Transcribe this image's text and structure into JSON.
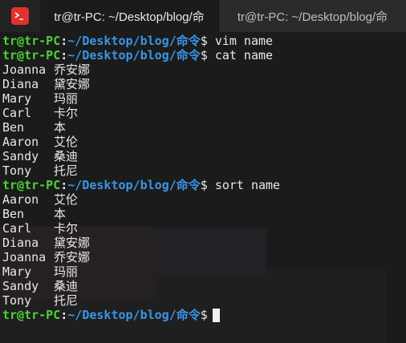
{
  "tabs": [
    {
      "title": "tr@tr-PC: ~/Desktop/blog/命",
      "active": true
    },
    {
      "title": "tr@tr-PC: ~/Desktop/blog/命",
      "active": false
    }
  ],
  "prompt": {
    "user_host": "tr@tr-PC",
    "colon": ":",
    "path": "~/Desktop/blog/命令",
    "symbol": "$"
  },
  "commands": {
    "vim": "vim name",
    "cat": "cat name",
    "sort": "sort name"
  },
  "cat_output": [
    {
      "en": "Joanna",
      "cn": "乔安娜"
    },
    {
      "en": "Diana",
      "cn": "黛安娜"
    },
    {
      "en": "Mary",
      "cn": "玛丽"
    },
    {
      "en": "Carl",
      "cn": "卡尔"
    },
    {
      "en": "Ben",
      "cn": "本"
    },
    {
      "en": "Aaron",
      "cn": "艾伦"
    },
    {
      "en": "Sandy",
      "cn": "桑迪"
    },
    {
      "en": "Tony",
      "cn": "托尼"
    }
  ],
  "sort_output": [
    {
      "en": "Aaron",
      "cn": "艾伦"
    },
    {
      "en": "Ben",
      "cn": "本"
    },
    {
      "en": "Carl",
      "cn": "卡尔"
    },
    {
      "en": "Diana",
      "cn": "黛安娜"
    },
    {
      "en": "Joanna",
      "cn": "乔安娜"
    },
    {
      "en": "Mary",
      "cn": "玛丽"
    },
    {
      "en": "Sandy",
      "cn": "桑迪"
    },
    {
      "en": "Tony",
      "cn": "托尼"
    }
  ],
  "colors": {
    "user": "#4cd137",
    "path": "#3b95e6",
    "text": "#e8e8e8",
    "background": "#1b1b1b",
    "app_icon": "#e0322e"
  },
  "icons": {
    "app": "terminal-app-icon"
  }
}
